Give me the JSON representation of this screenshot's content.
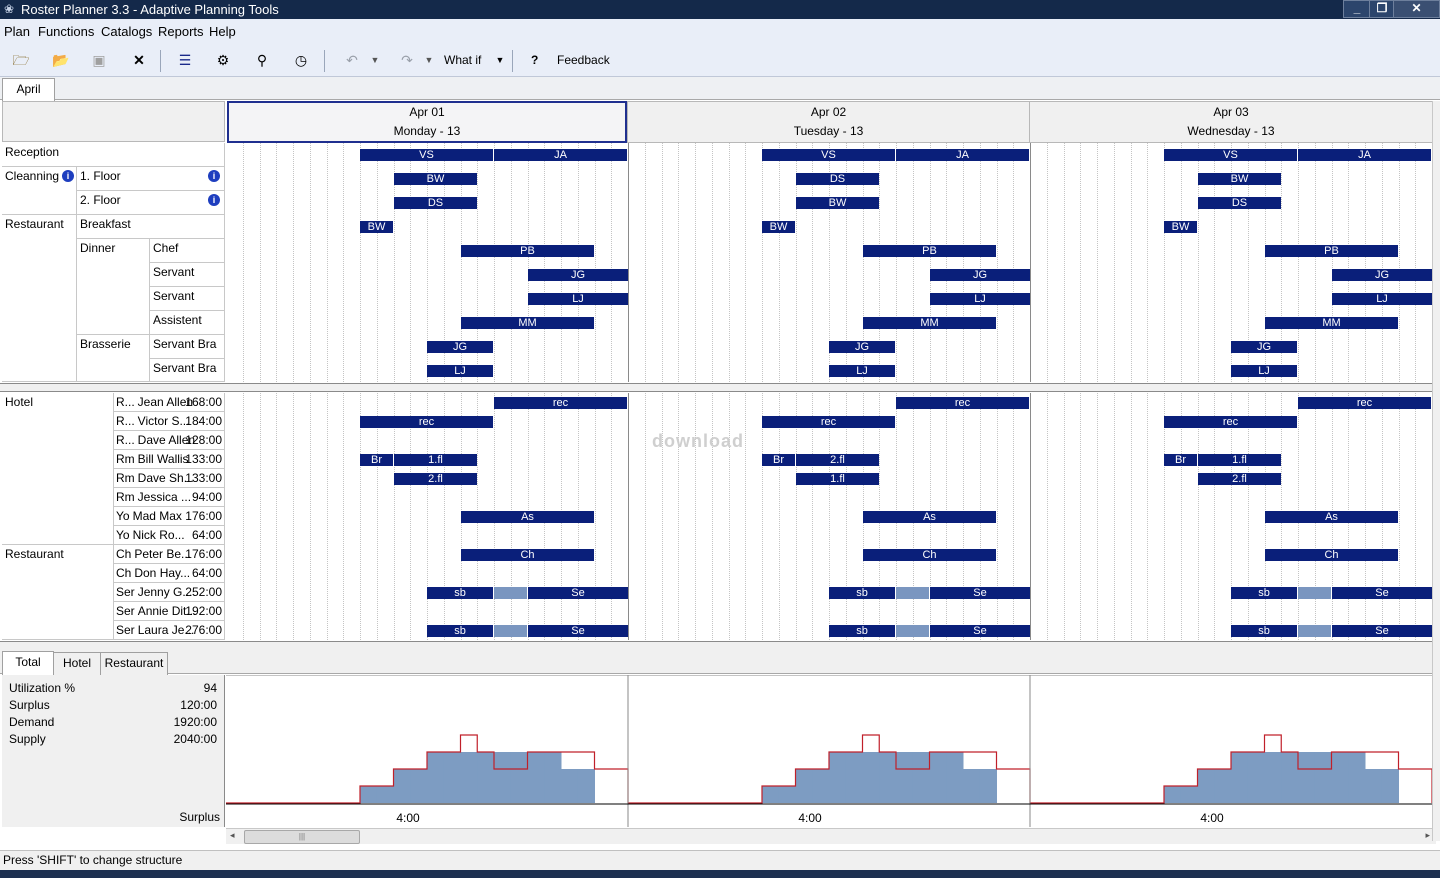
{
  "window": {
    "title": "Roster Planner 3.3 - Adaptive Planning Tools",
    "minimize": "_",
    "restore": "❐",
    "close": "✕"
  },
  "menu": [
    "Plan",
    "Functions",
    "Catalogs",
    "Reports",
    "Help"
  ],
  "toolbar": {
    "whatif_label": "What if",
    "help_label": "?",
    "feedback_label": "Feedback"
  },
  "month_tab": "April",
  "days": [
    {
      "date": "Apr 01",
      "weekday": "Monday - 13",
      "selected": true
    },
    {
      "date": "Apr 02",
      "weekday": "Tuesday - 13",
      "selected": false
    },
    {
      "date": "Apr 03",
      "weekday": "Wednesday - 13",
      "selected": false
    }
  ],
  "structure": {
    "reception": "Reception",
    "cleaning": "Cleanning",
    "floor1": "1. Floor",
    "floor2": "2. Floor",
    "restaurant": "Restaurant",
    "breakfast": "Breakfast",
    "dinner": "Dinner",
    "chef": "Chef",
    "servant": "Servant",
    "assistent": "Assistent",
    "brasserie": "Brasserie",
    "servant_bra": "Servant Bra",
    "info_glyph": "i"
  },
  "structure_bars": [
    [
      {
        "s": 8,
        "e": 16,
        "t": "VS"
      },
      {
        "s": 16,
        "e": 24,
        "t": "JA"
      }
    ],
    [
      {
        "s": 10,
        "e": 15,
        "t": "BW"
      }
    ],
    [
      {
        "s": 10,
        "e": 15,
        "t": "DS"
      }
    ],
    [
      {
        "s": 8,
        "e": 10,
        "t": "BW"
      }
    ],
    [
      {
        "s": 14,
        "e": 22,
        "t": "PB"
      }
    ],
    [
      {
        "s": 18,
        "e": 24,
        "t": "JG"
      }
    ],
    [
      {
        "s": 18,
        "e": 24,
        "t": "LJ"
      }
    ],
    [
      {
        "s": 14,
        "e": 22,
        "t": "MM"
      }
    ],
    [
      {
        "s": 12,
        "e": 16,
        "t": "JG"
      }
    ],
    [
      {
        "s": 12,
        "e": 16,
        "t": "LJ"
      }
    ]
  ],
  "structure_bars_day2_swap": {
    "row": 1,
    "alt_row_1": "DS",
    "alt_row_2": "BW"
  },
  "employees_group1": "Hotel",
  "employees_group2": "Restaurant",
  "employees": [
    {
      "role": "R...",
      "name": "Jean Allen",
      "hours": "168:00"
    },
    {
      "role": "R...",
      "name": "Victor S...",
      "hours": "184:00"
    },
    {
      "role": "R...",
      "name": "Dave Allen",
      "hours": "128:00"
    },
    {
      "role": "Rm",
      "name": "Bill Wallis",
      "hours": "133:00"
    },
    {
      "role": "Rm",
      "name": "Dave Sh...",
      "hours": "133:00"
    },
    {
      "role": "Rm",
      "name": "Jessica ...",
      "hours": "94:00"
    },
    {
      "role": "Yo",
      "name": "Mad Max",
      "hours": "176:00"
    },
    {
      "role": "Yo",
      "name": "Nick Ro...",
      "hours": "64:00"
    },
    {
      "role": "Ch",
      "name": "Peter Be...",
      "hours": "176:00"
    },
    {
      "role": "Ch",
      "name": "Don Hay...",
      "hours": "64:00"
    },
    {
      "role": "Ser",
      "name": "Jenny G...",
      "hours": "252:00"
    },
    {
      "role": "Ser",
      "name": "Annie Dit...",
      "hours": "192:00"
    },
    {
      "role": "Ser",
      "name": "Laura Je...",
      "hours": "276:00"
    }
  ],
  "employee_bars": [
    [
      {
        "s": 16,
        "e": 24,
        "t": "rec"
      }
    ],
    [
      {
        "s": 8,
        "e": 16,
        "t": "rec"
      }
    ],
    [],
    [
      {
        "s": 8,
        "e": 10,
        "t": "Br"
      },
      {
        "s": 10,
        "e": 15,
        "t": "1.fl"
      }
    ],
    [
      {
        "s": 10,
        "e": 15,
        "t": "2.fl"
      }
    ],
    [],
    [
      {
        "s": 14,
        "e": 22,
        "t": "As"
      }
    ],
    [],
    [
      {
        "s": 14,
        "e": 22,
        "t": "Ch"
      }
    ],
    [],
    [
      {
        "s": 12,
        "e": 16,
        "t": "sb"
      },
      {
        "s": 16,
        "e": 18,
        "t": "",
        "light": true
      },
      {
        "s": 18,
        "e": 24,
        "t": "Se"
      }
    ],
    [],
    [
      {
        "s": 12,
        "e": 16,
        "t": "sb"
      },
      {
        "s": 16,
        "e": 18,
        "t": "",
        "light": true
      },
      {
        "s": 18,
        "e": 24,
        "t": "Se"
      }
    ]
  ],
  "employee_bar_day_variants": {
    "day1": {
      "row3_second": "1.fl",
      "row4": "2.fl"
    },
    "day2": {
      "row3_second": "2.fl",
      "row4": "1.fl"
    },
    "day3": {
      "row3_second": "1.fl",
      "row4": "2.fl"
    }
  },
  "watermark": "download",
  "bottom_tabs": [
    "Total",
    "Hotel",
    "Restaurant"
  ],
  "stats": [
    {
      "label": "Utilization %",
      "value": "94"
    },
    {
      "label": "Surplus",
      "value": "120:00"
    },
    {
      "label": "Demand",
      "value": "1920:00"
    },
    {
      "label": "Supply",
      "value": "2040:00"
    }
  ],
  "surplus_label": "Surplus",
  "chart_data": {
    "type": "area",
    "series": [
      {
        "values": [
          0,
          0,
          0,
          0,
          0,
          0,
          0,
          0,
          1,
          1,
          2,
          2,
          3,
          3,
          3,
          3,
          3,
          3,
          3,
          3,
          2,
          2,
          0,
          0
        ]
      },
      {
        "values": [
          0,
          0,
          0,
          0,
          0,
          0,
          0,
          0,
          1,
          1,
          2,
          2,
          3,
          3,
          4,
          3,
          2,
          2,
          3,
          3,
          3,
          3,
          2,
          2
        ]
      }
    ],
    "categories": [
      "0",
      "1",
      "2",
      "3",
      "4",
      "5",
      "6",
      "7",
      "8",
      "9",
      "10",
      "11",
      "12",
      "13",
      "14",
      "15",
      "16",
      "17",
      "18",
      "19",
      "20",
      "21",
      "22",
      "23"
    ],
    "x_tick_label": "4:00",
    "colors": {
      "demand_fill": "#7d9cc2",
      "supply_line": "#c0202a"
    }
  },
  "status": "Press 'SHIFT' to change structure"
}
